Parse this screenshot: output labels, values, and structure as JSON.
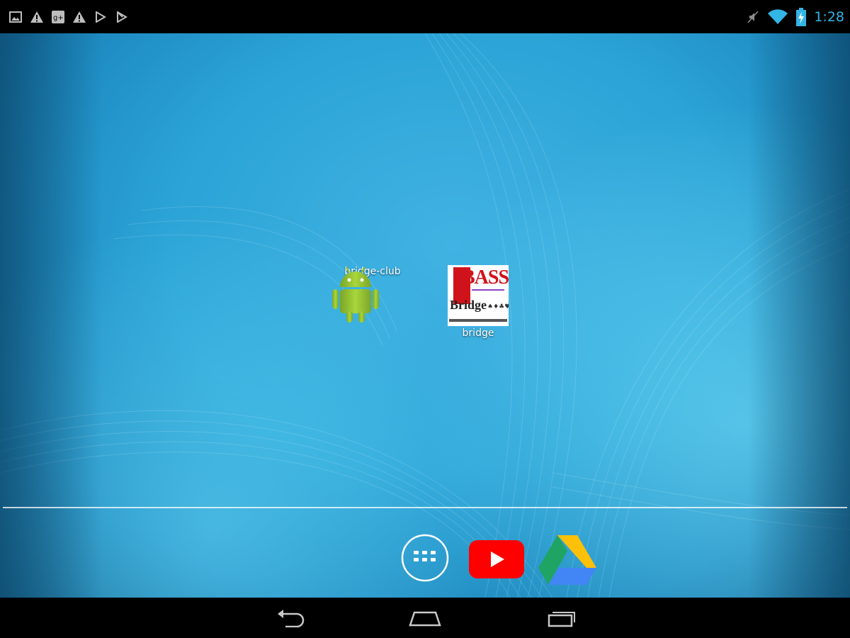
{
  "status_bar": {
    "notification_icons": [
      "image-icon",
      "warning-icon",
      "google-plus-icon",
      "warning-icon",
      "play-store-icon",
      "play-store-icon"
    ],
    "system_icons": [
      "silent-icon",
      "wifi-icon",
      "battery-charging-icon"
    ],
    "time": "1:28"
  },
  "desktop": {
    "apps": [
      {
        "label": "bridge-club",
        "icon": "android-icon"
      },
      {
        "label": "bridge",
        "icon": "bass-bridge-icon",
        "icon_text_top": "BASS",
        "icon_text_mid": "Bridge"
      }
    ]
  },
  "dock": {
    "items": [
      "app-drawer-icon",
      "youtube-icon",
      "google-drive-icon"
    ]
  },
  "nav_bar": {
    "buttons": [
      "back-icon",
      "home-icon",
      "recent-apps-icon"
    ]
  },
  "colors": {
    "clock": "#33b5e5",
    "wallpaper": "#2ba3d6",
    "youtube": "#ff0000"
  }
}
